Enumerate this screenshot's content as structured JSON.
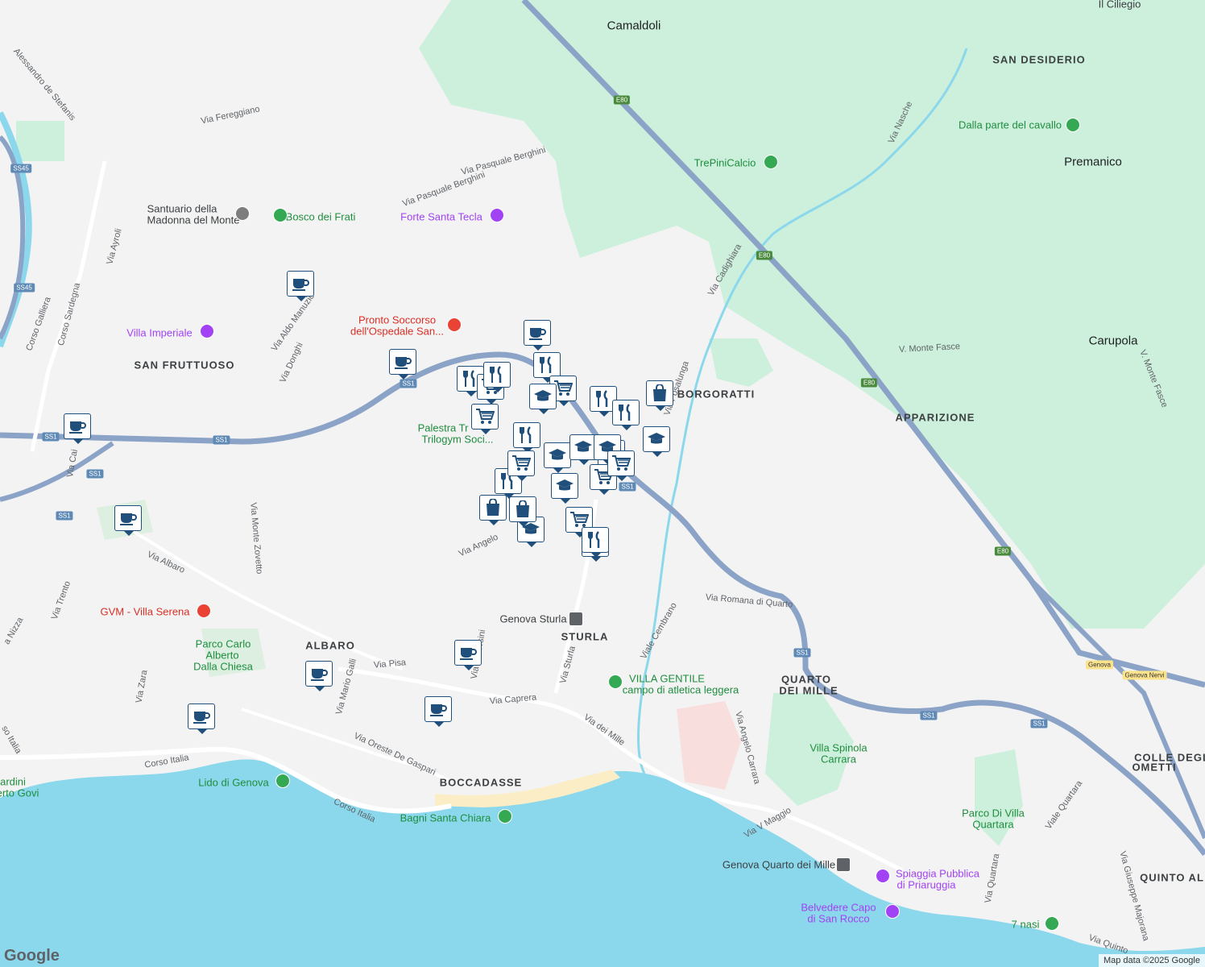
{
  "map": {
    "attribution": "Map data ©2025 Google",
    "logo": "Google",
    "colors": {
      "sea": "#8bd8ec",
      "land": "#f3f3f3",
      "park": "#cdf0dc",
      "highway": "#8ba3c7",
      "road": "#ffffff",
      "pin_border": "#1f4f7a"
    }
  },
  "labels": {
    "camaldoli": "Camaldoli",
    "san_desiderio": "SAN DESIDERIO",
    "premanico": "Premanico",
    "carupola": "Carupola",
    "borgoratti": "BORGORATTI",
    "apparizione": "APPARIZIONE",
    "san_fruttuoso": "SAN FRUTTUOSO",
    "albaro": "ALBARO",
    "sturla": "STURLA",
    "boccadasse": "BOCCADASSE",
    "quarto_dei_mille_1": "QUARTO",
    "quarto_dei_mille_2": "DEI MILLE",
    "colle_1": "COLLE DEGL",
    "colle_2": "OMETTI",
    "quinto": "QUINTO AL",
    "il_ciliegio": "Il Ciliegio",
    "dalla_parte": "Dalla parte del cavallo",
    "trepini": "TrePiniCalcio",
    "santuario_1": "Santuario della",
    "santuario_2": "Madonna del Monte",
    "bosco": "Bosco dei Frati",
    "forte": "Forte Santa Tecla",
    "pronto_1": "Pronto Soccorso",
    "pronto_2": "dell'Ospedale San...",
    "villa_imperiale": "Villa Imperiale",
    "palestra_1": "Palestra Tr",
    "palestra_2": "Trilogym Soci...",
    "gvm": "GVM - Villa Serena",
    "parco_carlo_1": "Parco Carlo",
    "parco_carlo_2": "Alberto",
    "parco_carlo_3": "Dalla Chiesa",
    "genova_sturla": "Genova Sturla",
    "villa_gentile_1": "VILLA GENTILE",
    "villa_gentile_2": "campo di atletica leggera",
    "villa_spinola_1": "Villa Spinola",
    "villa_spinola_2": "Carrara",
    "parco_quartara_1": "Parco Di Villa",
    "parco_quartara_2": "Quartara",
    "lido": "Lido di Genova",
    "bagni": "Bagni Santa Chiara",
    "genova_quarto": "Genova Quarto dei Mille",
    "spiaggia_1": "Spiaggia Pubblica",
    "spiaggia_2": "di Priaruggia",
    "belvedere_1": "Belvedere Capo",
    "belvedere_2": "di San Rocco",
    "sette_nasi": "7 nasi",
    "giardini_1": "ardini",
    "giardini_2": "erto Govi"
  },
  "streets": {
    "via_fereggiano": "Via Fereggiano",
    "via_pasquale_1": "Via Pasquale Berghini",
    "via_pasquale_2": "Via Pasquale Berghini",
    "alessandro": "Alessandro de Stefanis",
    "via_ayroli": "Via Ayroli",
    "corso_sardegna": "Corso Sardegna",
    "corso_galliera": "Corso Galliera",
    "via_aldo": "Via Aldo Manuzio",
    "via_donghi": "Via Donghi",
    "via_cadighiara": "Via Cadighiara",
    "via_nasche": "Via Nasche",
    "v_monte_fasce_1": "V. Monte Fasce",
    "v_monte_fasce_2": "V. Monte Fasce",
    "via_posalunga": "Via Posalunga",
    "via_monte_zovetto": "Via Monte Zovetto",
    "via_albaro": "Via Albaro",
    "via_trento": "Via Trento",
    "via_nizza": "a Nizza",
    "via_angelo": "Via Angelo",
    "via_romana": "Via Romana di Quarto",
    "viale_cembrano": "Viale Cembrano",
    "via_pisa": "Via Pisa",
    "via_mario_galli": "Via Mario Galli",
    "via_zara": "Via Zara",
    "via_orsini": "Via G. Orsini",
    "via_caprera": "Via Caprera",
    "via_sturla": "Via Sturla",
    "via_dei_mille": "Via dei Mille",
    "via_oreste": "Via Oreste De Gaspari",
    "corso_italia_1": "Corso Italia",
    "corso_italia_2": "Corso Italia",
    "via_angelo_carrara": "Via Angelo Carrara",
    "via_v_maggio": "Via V Maggio",
    "viale_quartara": "Viale Quartara",
    "via_quartara": "Via Quartara",
    "via_giuseppe": "Via Giuseppe Majorana",
    "via_quinto": "Via Quinto",
    "so_italia": "so Italia",
    "via_cai": "Via Cai"
  },
  "shields": {
    "e80": "E80",
    "ss1": "SS1",
    "ss45": "SS45",
    "genova": "Genova",
    "genova_nervi": "Genova Nervi"
  },
  "pins": [
    {
      "type": "cafe",
      "icon": "coffee-cup-icon"
    },
    {
      "type": "cafe",
      "icon": "coffee-cup-icon"
    },
    {
      "type": "cafe",
      "icon": "coffee-cup-icon"
    },
    {
      "type": "cafe",
      "icon": "coffee-cup-icon"
    },
    {
      "type": "cafe",
      "icon": "coffee-cup-icon"
    },
    {
      "type": "cafe",
      "icon": "coffee-cup-icon"
    },
    {
      "type": "cafe",
      "icon": "coffee-cup-icon"
    },
    {
      "type": "cafe",
      "icon": "coffee-cup-icon"
    },
    {
      "type": "cafe",
      "icon": "coffee-cup-icon"
    },
    {
      "type": "restaurant",
      "icon": "fork-knife-icon"
    },
    {
      "type": "restaurant",
      "icon": "fork-knife-icon"
    },
    {
      "type": "restaurant",
      "icon": "fork-knife-icon"
    },
    {
      "type": "restaurant",
      "icon": "fork-knife-icon"
    },
    {
      "type": "restaurant",
      "icon": "fork-knife-icon"
    },
    {
      "type": "restaurant",
      "icon": "fork-knife-icon"
    },
    {
      "type": "restaurant",
      "icon": "fork-knife-icon"
    },
    {
      "type": "grocery",
      "icon": "shopping-cart-icon"
    },
    {
      "type": "grocery",
      "icon": "shopping-cart-icon"
    },
    {
      "type": "grocery",
      "icon": "shopping-cart-icon"
    },
    {
      "type": "grocery",
      "icon": "shopping-cart-icon"
    },
    {
      "type": "grocery",
      "icon": "shopping-cart-icon"
    },
    {
      "type": "grocery",
      "icon": "shopping-cart-icon"
    },
    {
      "type": "grocery",
      "icon": "shopping-cart-icon"
    },
    {
      "type": "school",
      "icon": "graduation-cap-icon"
    },
    {
      "type": "school",
      "icon": "graduation-cap-icon"
    },
    {
      "type": "school",
      "icon": "graduation-cap-icon"
    },
    {
      "type": "school",
      "icon": "graduation-cap-icon"
    },
    {
      "type": "school",
      "icon": "graduation-cap-icon"
    },
    {
      "type": "school",
      "icon": "graduation-cap-icon"
    },
    {
      "type": "school",
      "icon": "graduation-cap-icon"
    },
    {
      "type": "shopping",
      "icon": "shopping-bag-icon"
    },
    {
      "type": "shopping",
      "icon": "shopping-bag-icon"
    },
    {
      "type": "shopping",
      "icon": "shopping-bag-icon"
    },
    {
      "type": "restaurant",
      "icon": "fork-knife-icon"
    },
    {
      "type": "grocery",
      "icon": "shopping-cart-icon"
    },
    {
      "type": "restaurant",
      "icon": "fork-knife-icon"
    }
  ]
}
